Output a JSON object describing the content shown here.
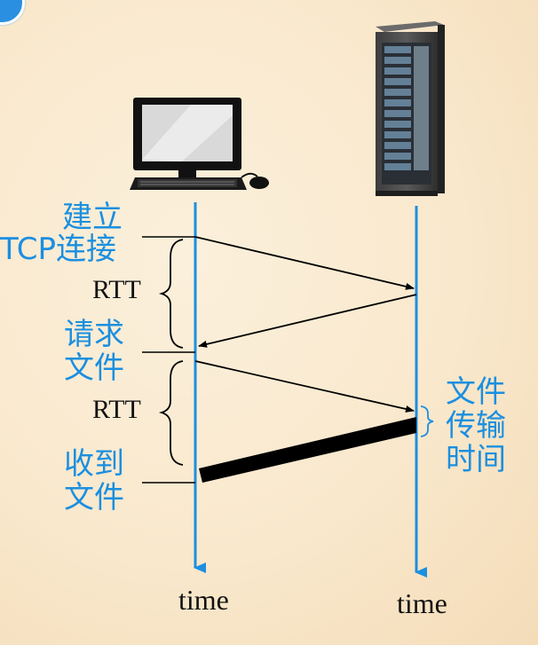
{
  "labels": {
    "establish_line1": "建立",
    "establish_line2": "TCP连接",
    "request_line1": "请求",
    "request_line2": "文件",
    "receive_line1": "收到",
    "receive_line2": "文件",
    "transfer_line1": "文件",
    "transfer_line2": "传输",
    "transfer_line3": "时间",
    "rtt_1": "RTT",
    "rtt_2": "RTT",
    "time_client": "time",
    "time_server": "time"
  },
  "colors": {
    "timeline": "#1b8fe0",
    "label_blue": "#1b8fe0",
    "arrow": "#000000",
    "background": "#fbf0dc"
  },
  "icons": {
    "client": "desktop-computer-icon",
    "server": "server-rack-icon"
  }
}
